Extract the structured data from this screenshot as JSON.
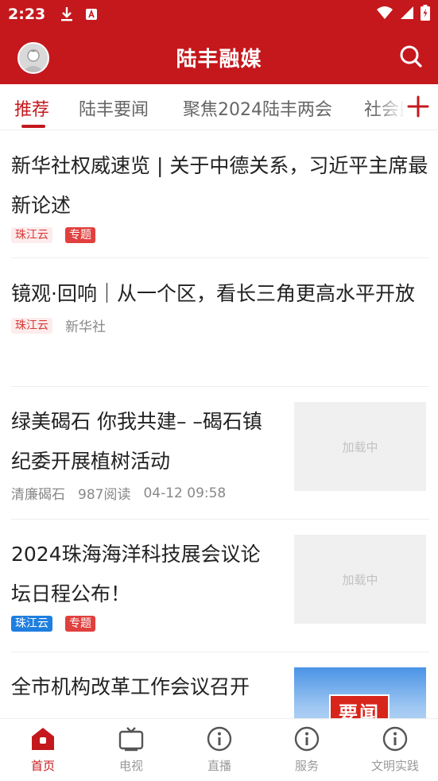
{
  "status_bar": {
    "time": "2:23",
    "icons": [
      "download-icon",
      "notification-a-icon",
      "wifi-icon",
      "signal-icon",
      "battery-charging-icon"
    ]
  },
  "header": {
    "title": "陆丰融媒",
    "avatar_icon": "user-avatar-icon",
    "search_icon": "search-icon"
  },
  "tabs": [
    {
      "label": "推荐",
      "active": true
    },
    {
      "label": "陆丰要闻",
      "active": false
    },
    {
      "label": "聚焦2024陆丰两会",
      "active": false
    },
    {
      "label": "社会民",
      "active": false
    }
  ],
  "tab_add_icon": "plus-icon",
  "feed": [
    {
      "title": "新华社权威速览 | 关于中德关系，习近平主席最新论述",
      "tags": [
        "珠江云",
        "专题"
      ],
      "meta": []
    },
    {
      "title": "镜观·回响｜从一个区，看长三角更高水平开放",
      "tags": [
        "珠江云"
      ],
      "meta": [
        "新华社"
      ]
    },
    {
      "title": "绿美碣石 你我共建– –碣石镇纪委开展植树活动",
      "tags": [],
      "meta": [
        "清廉碣石",
        "987阅读",
        "04-12 09:58"
      ],
      "thumb": "加载中"
    },
    {
      "title": "2024珠海海洋科技展会议论坛日程公布！",
      "tags": [
        "珠江云",
        "专题"
      ],
      "meta": [],
      "thumb": "加载中"
    },
    {
      "title": "全市机构改革工作会议召开",
      "tags": [],
      "meta": [],
      "thumb_badge": "要闻"
    }
  ],
  "bottom_nav": [
    {
      "label": "首页",
      "icon": "home-icon",
      "active": true
    },
    {
      "label": "电视",
      "icon": "tv-icon",
      "active": false
    },
    {
      "label": "直播",
      "icon": "info-icon",
      "active": false
    },
    {
      "label": "服务",
      "icon": "info-icon",
      "active": false
    },
    {
      "label": "文明实践",
      "icon": "info-icon",
      "active": false
    }
  ],
  "colors": {
    "brand_red": "#c4181d",
    "tag_blue": "#1e7fe0",
    "text_gray": "#888888"
  }
}
